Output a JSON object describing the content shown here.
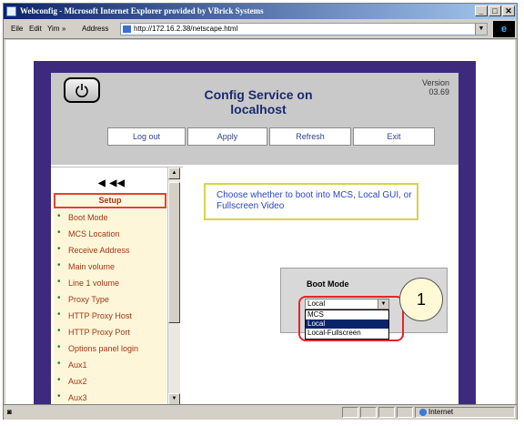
{
  "window": {
    "title": "Webconfig - Microsoft Internet Explorer provided by VBrick Systems",
    "min": "_",
    "max": "□",
    "close": "✕"
  },
  "menubar": {
    "file": "Eile",
    "edit": "Edit",
    "view": "Yim",
    "more": "»",
    "address_label": "Address",
    "url": "http://172.16.2.38/netscape.html"
  },
  "header": {
    "title_line1": "Config Service on",
    "title_line2": "localhost",
    "version_label": "Version",
    "version_value": "03.69",
    "buttons": [
      "Log out",
      "Apply",
      "Refresh",
      "Exit"
    ]
  },
  "sidebar": {
    "arrows": "◀ ◀◀",
    "setup_label": "Setup",
    "items": [
      "Boot Mode",
      "MCS Location",
      "Receive Address",
      "Main volume",
      "Line 1 volume",
      "Proxy Type",
      "HTTP Proxy Host",
      "HTTP Proxy Port",
      "Options panel login",
      "Aux1",
      "Aux2",
      "Aux3"
    ]
  },
  "help_text": "Choose whether to boot into MCS, Local GUI, or Fullscreen Video",
  "boot_mode": {
    "title": "Boot Mode",
    "selected": "Local",
    "options": [
      "MCS",
      "Local",
      "Local-Fullscreen"
    ]
  },
  "callout_number": "1",
  "status": {
    "zone": "Internet"
  },
  "colors": {
    "frame": "#3d2a7d",
    "menu_bg": "#fdf6d9",
    "menu_text": "#a43614",
    "highlight": "#e5232a"
  }
}
